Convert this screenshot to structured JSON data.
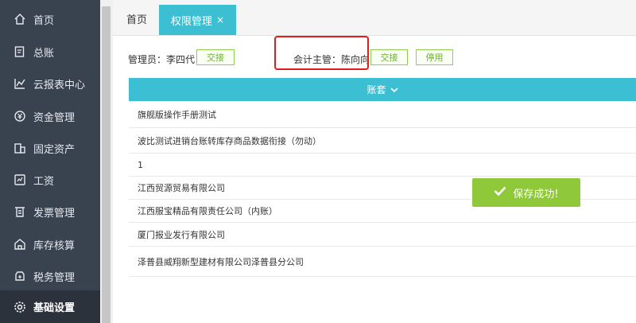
{
  "sidebar": {
    "items": [
      {
        "label": "首页",
        "icon": "home-icon"
      },
      {
        "label": "总账",
        "icon": "ledger-icon"
      },
      {
        "label": "云报表中心",
        "icon": "chart-icon"
      },
      {
        "label": "资金管理",
        "icon": "money-icon"
      },
      {
        "label": "固定资产",
        "icon": "building-icon"
      },
      {
        "label": "工资",
        "icon": "salary-icon"
      },
      {
        "label": "发票管理",
        "icon": "invoice-icon"
      },
      {
        "label": "库存核算",
        "icon": "warehouse-icon"
      },
      {
        "label": "税务管理",
        "icon": "tax-icon"
      },
      {
        "label": "基础设置",
        "icon": "gear-icon"
      }
    ],
    "active": "基础设置"
  },
  "tabs": {
    "home": "首页",
    "active": "权限管理",
    "close": "×"
  },
  "toolbar": {
    "admin_label": "管理员：李四代",
    "admin_transfer": "交接",
    "accountant_label": "会计主管：陈向向",
    "accountant_transfer": "交接",
    "disable": "停用"
  },
  "table": {
    "header": "账套",
    "rows": [
      "旗舰版操作手册测试",
      "波比测试进销台账转库存商品数据衔接（勿动）",
      "1",
      "江西贸源贸易有限公司",
      "江西服宝精品有限责任公司（内账）",
      "厦门报业发行有限公司",
      "泽普县威翔新型建材有限公司泽普县分公司"
    ]
  },
  "toast": {
    "message": "保存成功!",
    "icon": "check-icon"
  },
  "colors": {
    "sidebar_bg": "#39424f",
    "accent": "#3cbfd3",
    "green": "#8fc93a",
    "highlight": "#e41c1c"
  }
}
